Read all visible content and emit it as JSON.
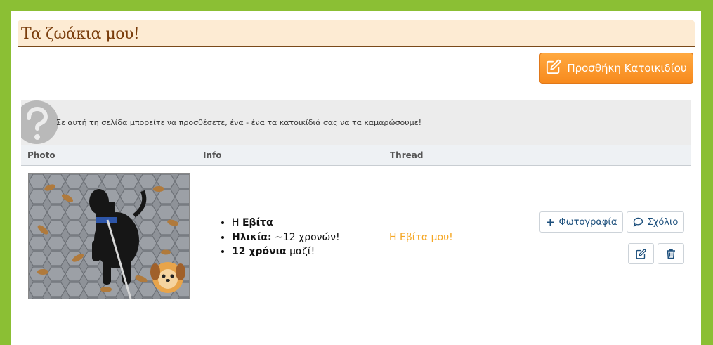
{
  "page": {
    "title": "Τα ζωάκια μου!",
    "add_button_label": "Προσθήκη Κατοικιδίου"
  },
  "help": {
    "text": "Σε αυτή τη σελίδα μπορείτε να προσθέσετε, ένα - ένα τα κατοικίδιά σας να τα καμαρώσουμε!"
  },
  "table": {
    "headers": [
      "Photo",
      "Info",
      "Thread"
    ],
    "rows": [
      {
        "info": {
          "name_prefix": "Η ",
          "name": "Εβίτα",
          "age_label": "Ηλικία:",
          "age_value": " ~12 χρονών!",
          "together_bold": "12 χρόνια",
          "together_rest": " μαζί!"
        },
        "thread_link": "Η Εβίτα μου!",
        "actions": {
          "photo_label": "Φωτογραφία",
          "comment_label": "Σχόλιο"
        }
      }
    ]
  },
  "colors": {
    "page_background": "#8bbf34",
    "title_background": "#fdebd3",
    "title_text": "#7a3d0c",
    "add_button": "#f78a1d",
    "thread_link": "#f5a623",
    "action_text": "#1c4f7c"
  },
  "icons": {
    "add": "edit-square-icon",
    "help": "question-mark-icon",
    "photo": "plus-icon",
    "comment": "speech-bubble-icon",
    "edit": "edit-icon",
    "delete": "trash-icon"
  }
}
